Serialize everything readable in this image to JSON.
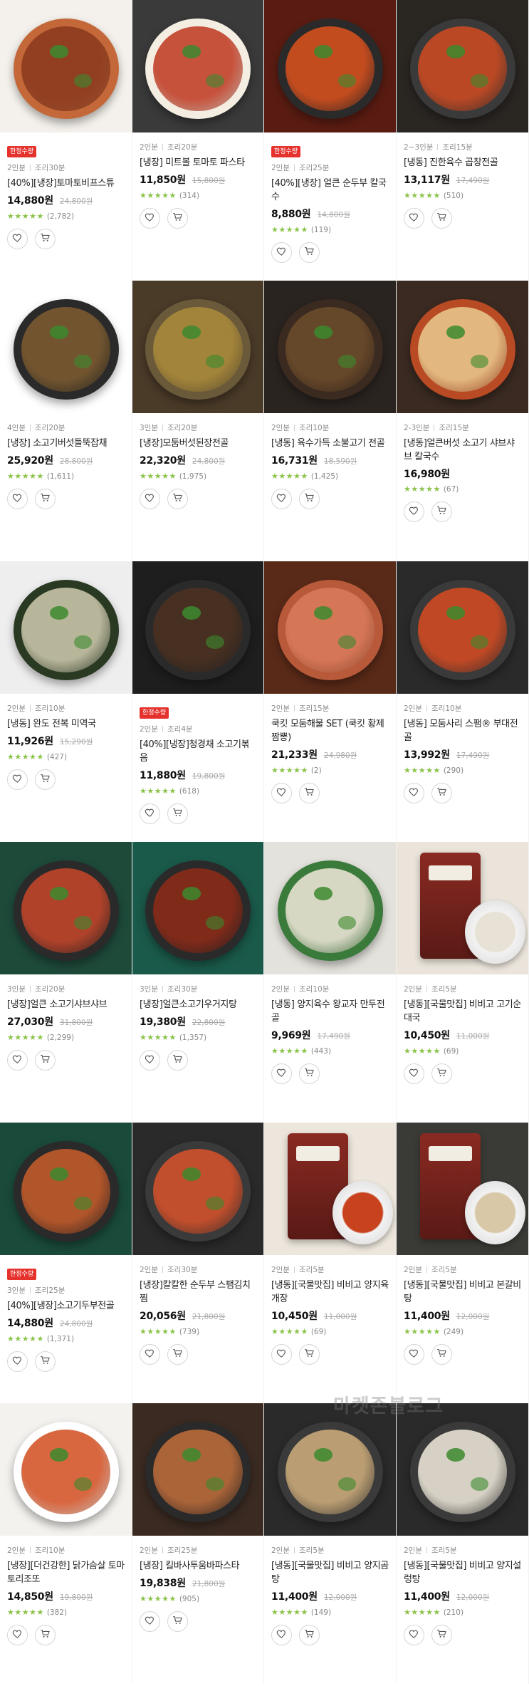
{
  "watermark": "마켓존블로그",
  "labels": {
    "separator": "",
    "heart_icon": "heart-icon",
    "cart_icon": "cart-icon"
  },
  "colors": {
    "badge": "#e5322d",
    "stars": "#8bc34a",
    "price": "#111111",
    "original_price": "#aaaaaa"
  },
  "products": [
    {
      "badge": "한정수량",
      "servings": "2인분",
      "cook_time": "조리30분",
      "name": "[40%][냉장]토마토비프스튜",
      "price": "14,880원",
      "orig_price": "24,800원",
      "stars": "★★★★★",
      "reviews": "(2,782)",
      "colors": [
        "#f4f1ec",
        "#c4683a",
        "#8c3a1e"
      ]
    },
    {
      "badge": "",
      "servings": "2인분",
      "cook_time": "조리20분",
      "name": "[냉장] 미트볼 토마토 파스타",
      "price": "11,850원",
      "orig_price": "15,800원",
      "stars": "★★★★★",
      "reviews": "(314)",
      "colors": [
        "#3a3a3a",
        "#f3ede2",
        "#c2412a"
      ]
    },
    {
      "badge": "한정수량",
      "servings": "2인분",
      "cook_time": "조리25분",
      "name": "[40%][냉장] 얼큰 순두부 칼국수",
      "price": "8,880원",
      "orig_price": "14,800원",
      "stars": "★★★★★",
      "reviews": "(119)",
      "colors": [
        "#5a1c12",
        "#2a2a2a",
        "#d4501e"
      ]
    },
    {
      "badge": "",
      "servings": "2~3인분",
      "cook_time": "조리15분",
      "name": "[냉동] 진한육수 곱창전골",
      "price": "13,117원",
      "orig_price": "17,490원",
      "stars": "★★★★★",
      "reviews": "(510)",
      "colors": [
        "#2a2622",
        "#3a3a3a",
        "#c84a22"
      ]
    },
    {
      "badge": "",
      "servings": "4인분",
      "cook_time": "조리20분",
      "name": "[냉장] 소고기버섯들뚝잡채",
      "price": "25,920원",
      "orig_price": "28,800원",
      "stars": "★★★★★",
      "reviews": "(1,611)",
      "colors": [
        "#ffffff",
        "#2a2a2a",
        "#7a5a30"
      ]
    },
    {
      "badge": "",
      "servings": "3인분",
      "cook_time": "조리20분",
      "name": "[냉장]모둠버섯된장전골",
      "price": "22,320원",
      "orig_price": "24,800원",
      "stars": "★★★★★",
      "reviews": "(1,975)",
      "colors": [
        "#4a3a28",
        "#6a5a3a",
        "#a8883a"
      ]
    },
    {
      "badge": "",
      "servings": "2인분",
      "cook_time": "조리10분",
      "name": "[냉동] 육수가득 소불고기 전골",
      "price": "16,731원",
      "orig_price": "18,590원",
      "stars": "★★★★★",
      "reviews": "(1,425)",
      "colors": [
        "#2a2420",
        "#3a2a20",
        "#6a4a2a"
      ]
    },
    {
      "badge": "",
      "servings": "2-3인분",
      "cook_time": "조리15분",
      "name": "[냉동]얼큰버섯 소고기 샤브샤브 칼국수",
      "price": "16,980원",
      "orig_price": "",
      "stars": "★★★★★",
      "reviews": "(67)",
      "colors": [
        "#3a2a22",
        "#b84a24",
        "#e8c48a"
      ]
    },
    {
      "badge": "",
      "servings": "2인분",
      "cook_time": "조리10분",
      "name": "[냉동] 완도 전복 미역국",
      "price": "11,926원",
      "orig_price": "15,290원",
      "stars": "★★★★★",
      "reviews": "(427)",
      "colors": [
        "#eeeeee",
        "#2a3a22",
        "#c8c4a8"
      ]
    },
    {
      "badge": "한정수량",
      "servings": "2인분",
      "cook_time": "조리4분",
      "name": "[40%][냉장]청경채 소고기볶음",
      "price": "11,880원",
      "orig_price": "19,800원",
      "stars": "★★★★★",
      "reviews": "(618)",
      "colors": [
        "#1e1e1e",
        "#2a2a2a",
        "#4a3020"
      ]
    },
    {
      "badge": "",
      "servings": "2인분",
      "cook_time": "조리15분",
      "name": "쿡킷 모둠해물 SET (쿡킷 황제짬뽕)",
      "price": "21,233원",
      "orig_price": "24,980원",
      "stars": "★★★★★",
      "reviews": "(2)",
      "colors": [
        "#5a2a18",
        "#b85a3a",
        "#d87a5a"
      ]
    },
    {
      "badge": "",
      "servings": "2인분",
      "cook_time": "조리10분",
      "name": "[냉동] 모둠사리 스팸® 부대전골",
      "price": "13,992원",
      "orig_price": "17,490원",
      "stars": "★★★★★",
      "reviews": "(290)",
      "colors": [
        "#2a2a2a",
        "#3a3a3a",
        "#d04a22"
      ]
    },
    {
      "badge": "",
      "servings": "3인분",
      "cook_time": "조리20분",
      "name": "[냉장]얼큰 소고기샤브샤브",
      "price": "27,030원",
      "orig_price": "31,800원",
      "stars": "★★★★★",
      "reviews": "(2,299)",
      "colors": [
        "#1e4a3a",
        "#2a2a2a",
        "#c0452a"
      ]
    },
    {
      "badge": "",
      "servings": "3인분",
      "cook_time": "조리30분",
      "name": "[냉장]얼큰소고기우거지탕",
      "price": "19,380원",
      "orig_price": "22,800원",
      "stars": "★★★★★",
      "reviews": "(1,357)",
      "colors": [
        "#1a5a4a",
        "#2a2a2a",
        "#8a2a18"
      ]
    },
    {
      "badge": "",
      "servings": "2인분",
      "cook_time": "조리10분",
      "name": "[냉동] 양지육수 왕교자 만두전골",
      "price": "9,969원",
      "orig_price": "17,490원",
      "stars": "★★★★★",
      "reviews": "(443)",
      "colors": [
        "#e4e2dc",
        "#3a7a3a",
        "#e8e2d2"
      ]
    },
    {
      "badge": "",
      "servings": "2인분",
      "cook_time": "조리5분",
      "name": "[냉동][국물맛집] 비비고 고기순대국",
      "price": "10,450원",
      "orig_price": "11,000원",
      "stars": "★★★★★",
      "reviews": "(69)",
      "colors": [
        "#eae4da",
        "#5a3a2a",
        "#e8e2d6"
      ]
    },
    {
      "badge": "한정수량",
      "servings": "3인분",
      "cook_time": "조리25분",
      "name": "[40%][냉장]소고기두부전골",
      "price": "14,880원",
      "orig_price": "24,800원",
      "stars": "★★★★★",
      "reviews": "(1,371)",
      "colors": [
        "#1a4a3a",
        "#2a2a2a",
        "#c05a2a"
      ]
    },
    {
      "badge": "",
      "servings": "2인분",
      "cook_time": "조리30분",
      "name": "[냉장]칼칼한 순두부 스팸김치찜",
      "price": "20,056원",
      "orig_price": "21,800원",
      "stars": "★★★★★",
      "reviews": "(739)",
      "colors": [
        "#2a2a2a",
        "#3a3a3a",
        "#d0502a"
      ]
    },
    {
      "badge": "",
      "servings": "2인분",
      "cook_time": "조리5분",
      "name": "[냉동][국물맛집] 비비고 양지육개장",
      "price": "10,450원",
      "orig_price": "11,000원",
      "stars": "★★★★★",
      "reviews": "(69)",
      "colors": [
        "#ece6dc",
        "#8a2a22",
        "#c8421e"
      ]
    },
    {
      "badge": "",
      "servings": "2인분",
      "cook_time": "조리5분",
      "name": "[냉동][국물맛집] 비비고 본갈비탕",
      "price": "11,400원",
      "orig_price": "12,000원",
      "stars": "★★★★★",
      "reviews": "(249)",
      "colors": [
        "#3a3a36",
        "#2a4a3a",
        "#d8c8a8"
      ]
    },
    {
      "badge": "",
      "servings": "2인분",
      "cook_time": "조리10분",
      "name": "[냉장][더건강한] 닭가슴살 토마토리조또",
      "price": "14,850원",
      "orig_price": "19,800원",
      "stars": "★★★★★",
      "reviews": "(382)",
      "colors": [
        "#f4f2ee",
        "#ffffff",
        "#d4562a"
      ]
    },
    {
      "badge": "",
      "servings": "2인분",
      "cook_time": "조리25분",
      "name": "[냉장] 킬바사투움바파스타",
      "price": "19,838원",
      "orig_price": "21,800원",
      "stars": "★★★★★",
      "reviews": "(905)",
      "colors": [
        "#3a2a22",
        "#2a2a2a",
        "#b86a3a"
      ]
    },
    {
      "badge": "",
      "servings": "2인분",
      "cook_time": "조리5분",
      "name": "[냉동][국물맛집] 비비고 양지곰탕",
      "price": "11,400원",
      "orig_price": "12,000원",
      "stars": "★★★★★",
      "reviews": "(149)",
      "colors": [
        "#2a2a2a",
        "#3a3a3a",
        "#c8a878"
      ]
    },
    {
      "badge": "",
      "servings": "2인분",
      "cook_time": "조리5분",
      "name": "[냉동][국물맛집] 비비고 양지설렁탕",
      "price": "11,400원",
      "orig_price": "12,000원",
      "stars": "★★★★★",
      "reviews": "(210)",
      "colors": [
        "#2a2a2a",
        "#3a3a3a",
        "#e8e2d4"
      ]
    }
  ]
}
